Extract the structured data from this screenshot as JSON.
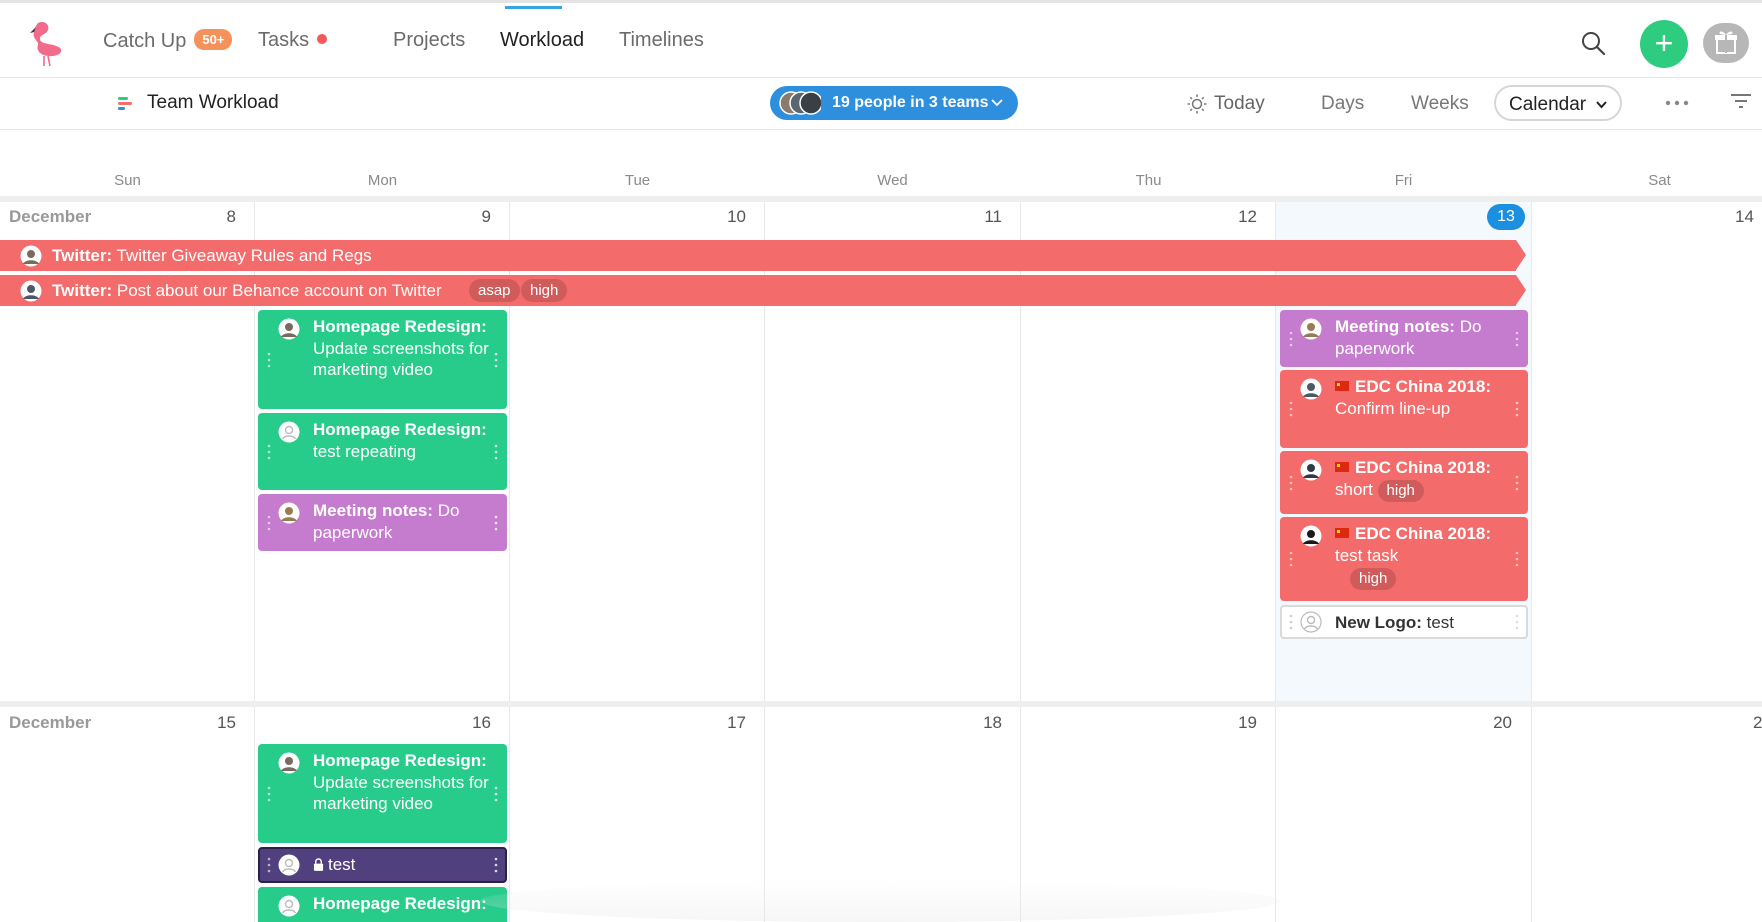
{
  "nav": {
    "catch_up": "Catch Up",
    "catch_up_badge": "50+",
    "tasks": "Tasks",
    "projects": "Projects",
    "workload": "Workload",
    "timelines": "Timelines"
  },
  "toolbar": {
    "title": "Team Workload",
    "people": "19 people in 3 teams",
    "today": "Today",
    "days": "Days",
    "weeks": "Weeks",
    "view": "Calendar"
  },
  "calendar": {
    "weekdays": [
      "Sun",
      "Mon",
      "Tue",
      "Wed",
      "Thu",
      "Fri",
      "Sat"
    ],
    "week1": {
      "month": "December",
      "days": [
        "8",
        "9",
        "10",
        "11",
        "12",
        "13",
        "14"
      ]
    },
    "week2": {
      "month": "December",
      "days": [
        "15",
        "16",
        "17",
        "18",
        "19",
        "20",
        "2"
      ]
    },
    "span_tasks": [
      {
        "project": "Twitter:",
        "title": "Twitter Giveaway Rules and Regs",
        "tags": []
      },
      {
        "project": "Twitter:",
        "title": "Post about our Behance account on Twitter",
        "tags": [
          "asap",
          "high"
        ]
      }
    ],
    "mon_tasks": [
      {
        "project": "Homepage Redesign:",
        "title": "Update screenshots for marketing video"
      },
      {
        "project": "Homepage Redesign:",
        "title": "test repeating"
      },
      {
        "project": "Meeting notes:",
        "title": "Do paperwork"
      }
    ],
    "fri_tasks": [
      {
        "project": "Meeting notes:",
        "title": "Do paperwork"
      },
      {
        "project": "EDC China 2018:",
        "title": "Confirm line-up"
      },
      {
        "project": "EDC China 2018:",
        "title": "short",
        "tag": "high"
      },
      {
        "project": "EDC China 2018:",
        "title": "test task",
        "tag": "high"
      },
      {
        "project": "New Logo:",
        "title": "test"
      }
    ],
    "mon2_tasks": [
      {
        "project": "Homepage Redesign:",
        "title": "Update screenshots for marketing video"
      },
      {
        "title": "test"
      },
      {
        "project": "Homepage Redesign:",
        "title": ""
      }
    ]
  },
  "colors": {
    "green": "#27cc8a",
    "purple": "#c57bce",
    "red": "#f36b6b",
    "accent": "#2d8fdd",
    "today": "#1b8fe0",
    "add": "#2ecc7f"
  }
}
